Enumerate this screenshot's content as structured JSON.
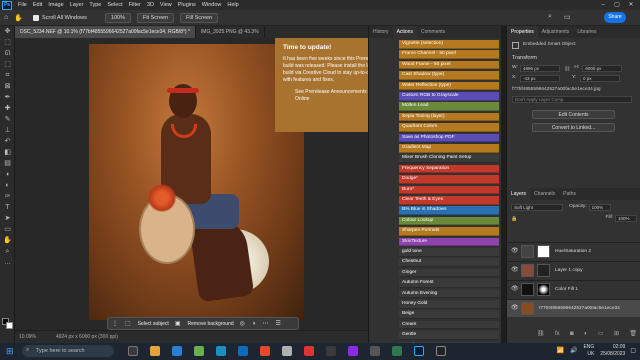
{
  "menubar": {
    "logo": "Ps",
    "items": [
      "File",
      "Edit",
      "Image",
      "Layer",
      "Type",
      "Select",
      "Filter",
      "3D",
      "View",
      "Plugins",
      "Window",
      "Help"
    ]
  },
  "optionsbar": {
    "scroll_all_windows": "Scroll All Windows",
    "zoom_100": "100%",
    "fit_screen": "Fit Screen",
    "fill_screen": "Fill Screen",
    "share": "Share"
  },
  "tabs": [
    "DSC_5234.NEF @ 10.1% (f77bf4855596642527a00fac5e1ece34, RGB/8*) *",
    "IMG_3925.PNG @ 43.3%"
  ],
  "popup": {
    "title": "Time to update!",
    "body": "It has been five weeks since this Prerelease build was released. Please install the latest build via Creative Cloud to stay up-to-date with features and fixes.",
    "link": "See Prerelease Announcements Online"
  },
  "actions_panel": {
    "tabs": [
      "History",
      "Actions",
      "Comments"
    ],
    "items": [
      {
        "label": "Vignette (selection)",
        "color": "#b5791f"
      },
      {
        "label": "Frame Channel - 50 pixel",
        "color": "#b5791f"
      },
      {
        "label": "Wood Frame - 50 pixel",
        "color": "#b5791f"
      },
      {
        "label": "Cast Shadow (type)",
        "color": "#b5791f"
      },
      {
        "label": "Water Reflection (type)",
        "color": "#b5791f"
      },
      {
        "label": "Custom RGB to Grayscale",
        "color": "#5b4db5"
      },
      {
        "label": "Molten Lead",
        "color": "#6a8a3a"
      },
      {
        "label": "Sepia Toning (layer)",
        "color": "#b5791f"
      },
      {
        "label": "Quadrant Colors",
        "color": "#b5791f"
      },
      {
        "label": "Save as Photoshop PDF",
        "color": "#5b4db5"
      },
      {
        "label": "Gradient Map",
        "color": "#b5791f"
      },
      {
        "label": "Mixer Brush Cloning Paint Setup",
        "color": "#3a3a3a"
      },
      {
        "label": "Frequency Separation",
        "color": "#c0392b"
      },
      {
        "label": "Dodge*",
        "color": "#c0392b"
      },
      {
        "label": "Burn*",
        "color": "#c0392b"
      },
      {
        "label": "Clear Teeth & Eyes",
        "color": "#c0392b"
      },
      {
        "label": "B% Blue in Shadows",
        "color": "#2a6fb0"
      },
      {
        "label": "Colour Lookup",
        "color": "#6a8a3a"
      },
      {
        "label": "Sharpen Portraits",
        "color": "#b5791f"
      },
      {
        "label": "SkinTexture",
        "color": "#8e44ad"
      },
      {
        "label": "gold tone",
        "color": "#3a3a3a"
      },
      {
        "label": "Chestnut",
        "color": "#3a3a3a"
      },
      {
        "label": "Ginger",
        "color": "#3a3a3a"
      },
      {
        "label": "Autumn Forest",
        "color": "#3a3a3a"
      },
      {
        "label": "Autumn Evening",
        "color": "#3a3a3a"
      },
      {
        "label": "Honey Gold",
        "color": "#3a3a3a"
      },
      {
        "label": "Beige",
        "color": "#3a3a3a"
      },
      {
        "label": "Cream",
        "color": "#3a3a3a"
      },
      {
        "label": "Gentle",
        "color": "#3a3a3a"
      },
      {
        "label": "Peach",
        "color": "#3a3a3a"
      }
    ]
  },
  "properties": {
    "tabs": [
      "Properties",
      "Adjustments",
      "Libraries"
    ],
    "type": "Embedded Smart Object",
    "transform_label": "Transform",
    "w_label": "W:",
    "w_value": "4896 px",
    "h_label": "H:",
    "h_value": "6000 px",
    "x_label": "X:",
    "x_value": "-43 px",
    "y_label": "Y:",
    "y_value": "0 px",
    "filename": "f77bf4855596642527a00fac5e1ece34.jpg",
    "layer_comp": "Don't Apply Layer Comp",
    "edit_contents": "Edit Contents",
    "convert_linked": "Convert to Linked..."
  },
  "layers": {
    "tabs": [
      "Layers",
      "Channels",
      "Paths"
    ],
    "blend_mode": "Soft Light",
    "opacity_label": "Opacity:",
    "opacity_value": "100%",
    "fill_label": "Fill:",
    "fill_value": "100%",
    "items": [
      {
        "name": "Hue/Saturation 2"
      },
      {
        "name": "Layer 1 copy"
      },
      {
        "name": "Color Fill 1"
      },
      {
        "name": "f77bf4855596642527a00fac5e1ece34"
      }
    ]
  },
  "taskbar_ctx": {
    "select_subject": "Select subject",
    "remove_background": "Remove background"
  },
  "statusbar": {
    "zoom": "10.09%",
    "info": "4924 px x 6000 px (300 ppi)"
  },
  "windows": {
    "search_placeholder": "Type here to search",
    "lang": "ENG",
    "region": "UK",
    "time": "02:09",
    "date": "25/08/2023"
  }
}
